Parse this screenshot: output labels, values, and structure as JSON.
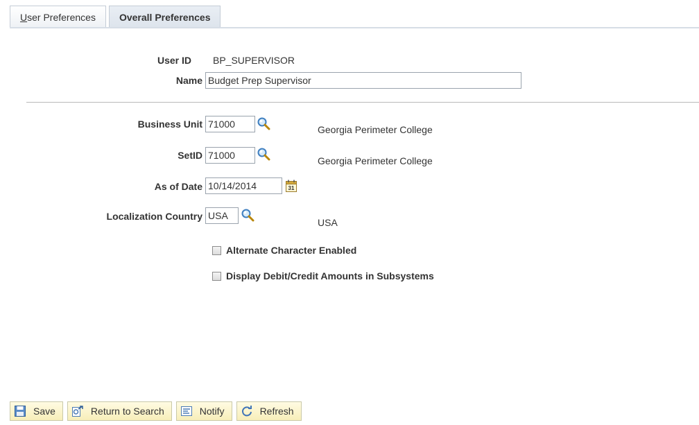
{
  "tabs": [
    {
      "label_underlined": "U",
      "label_rest": "ser Preferences",
      "active": false
    },
    {
      "label": "Overall Preferences",
      "active": true
    }
  ],
  "user": {
    "id_label": "User ID",
    "id_value": "BP_SUPERVISOR",
    "name_label": "Name",
    "name_value": "Budget Prep Supervisor"
  },
  "fields": {
    "business_unit": {
      "label": "Business Unit",
      "value": "71000",
      "description": "Georgia Perimeter College"
    },
    "setid": {
      "label": "SetID",
      "value": "71000",
      "description": "Georgia Perimeter College"
    },
    "as_of_date": {
      "label": "As of Date",
      "value": "10/14/2014"
    },
    "localization_country": {
      "label": "Localization Country",
      "value": "USA",
      "description": "USA"
    }
  },
  "checkboxes": {
    "alt_char": {
      "label": "Alternate Character Enabled",
      "checked": false
    },
    "debit_credit": {
      "label": "Display Debit/Credit Amounts in Subsystems",
      "checked": false
    }
  },
  "toolbar": {
    "save": "Save",
    "return_to_search": "Return to Search",
    "notify": "Notify",
    "refresh": "Refresh"
  },
  "icons": {
    "lookup": "magnifier-icon",
    "calendar": "calendar-icon",
    "save": "floppy-icon",
    "return": "return-icon",
    "notify": "notify-icon",
    "refresh": "refresh-icon"
  },
  "colors": {
    "button_bg": "#f7eeb9",
    "tab_active_bg": "#dde4ec"
  }
}
